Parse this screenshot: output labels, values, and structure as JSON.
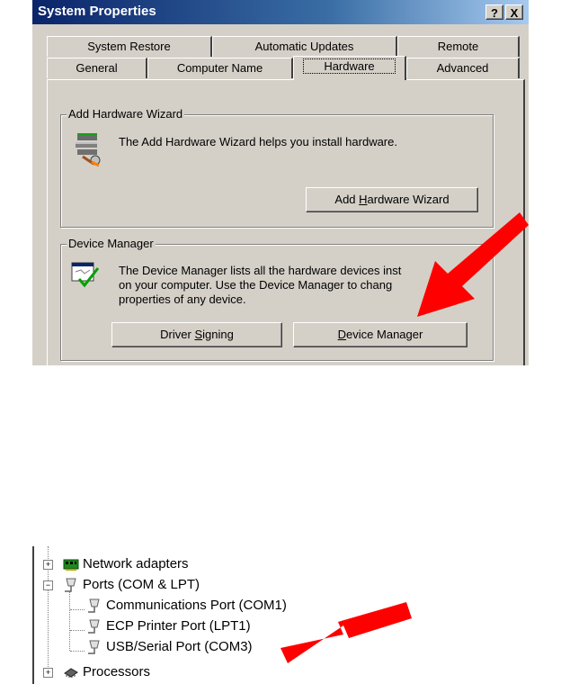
{
  "window": {
    "title": "System Properties",
    "help_button": "?",
    "close_button": "X"
  },
  "tabs": {
    "row1": [
      "System Restore",
      "Automatic Updates",
      "Remote"
    ],
    "row2": [
      "General",
      "Computer Name",
      "Hardware",
      "Advanced"
    ],
    "active": "Hardware"
  },
  "add_hardware": {
    "group_label": "Add Hardware Wizard",
    "description": "The Add Hardware Wizard helps you install hardware.",
    "button_pre": "Add ",
    "button_key": "H",
    "button_post": "ardware Wizard"
  },
  "device_manager": {
    "group_label": "Device Manager",
    "description_lines": [
      "The Device Manager lists all the hardware devices inst",
      "on your computer. Use the Device Manager to chang",
      "properties of any device."
    ],
    "driver_signing_pre": "Driver ",
    "driver_signing_key": "S",
    "driver_signing_post": "igning",
    "button_key": "D",
    "button_post": "evice Manager"
  },
  "tree": {
    "items": [
      {
        "label": "Network adapters",
        "expander": "+"
      },
      {
        "label": "Ports (COM & LPT)",
        "expander": "−"
      },
      {
        "label": "Communications Port (COM1)"
      },
      {
        "label": "ECP Printer Port (LPT1)"
      },
      {
        "label": "USB/Serial Port (COM3)"
      },
      {
        "label": "Processors",
        "expander": "+"
      }
    ]
  },
  "colors": {
    "title_bar": "#0a246a",
    "dialog_face": "#d4d0c8",
    "annotation_arrow": "#ff0000"
  }
}
